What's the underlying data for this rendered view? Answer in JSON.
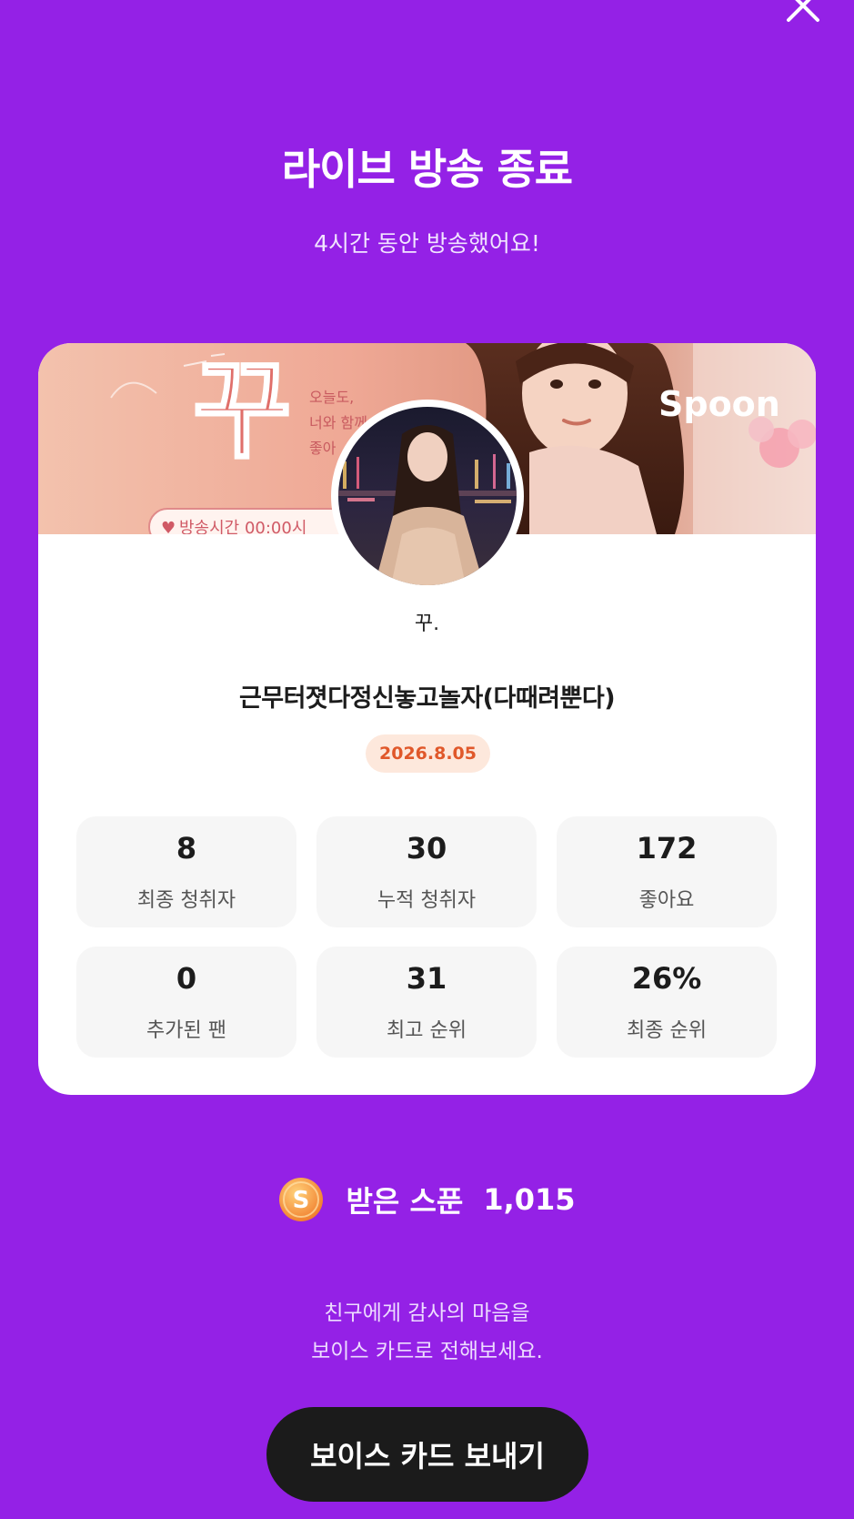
{
  "header": {
    "title": "라이브 방송 종료",
    "subtitle": "4시간 동안 방송했어요!",
    "close_icon": "close-icon"
  },
  "card": {
    "banner": {
      "big_char": "꾸",
      "side_text": [
        "오늘도,",
        "너와 함께",
        "좋아"
      ],
      "time_pill": "방송시간 00:00시",
      "brand": "Spoon"
    },
    "nickname": "꾸.",
    "live_title": "근무터졋다정신놓고놀자(다때려뿐다)",
    "date": "2026.8.05",
    "stats": [
      {
        "value": "8",
        "label": "최종 청취자"
      },
      {
        "value": "30",
        "label": "누적 청취자"
      },
      {
        "value": "172",
        "label": "좋아요"
      },
      {
        "value": "0",
        "label": "추가된 팬"
      },
      {
        "value": "31",
        "label": "최고 순위"
      },
      {
        "value": "26%",
        "label": "최종 순위"
      }
    ]
  },
  "spoons": {
    "icon": "spoon-coin-icon",
    "coin_letter": "S",
    "label": "받은 스푼",
    "value": "1,015"
  },
  "message": {
    "line1": "친구에게 감사의 마음을",
    "line2": "보이스 카드로 전해보세요."
  },
  "cta": {
    "label": "보이스 카드 보내기"
  },
  "colors": {
    "background": "#9421e6",
    "button": "#1b1b1b",
    "date_badge_bg": "#fde8dc",
    "date_badge_text": "#e0582a",
    "coin": "#f7a23c"
  }
}
